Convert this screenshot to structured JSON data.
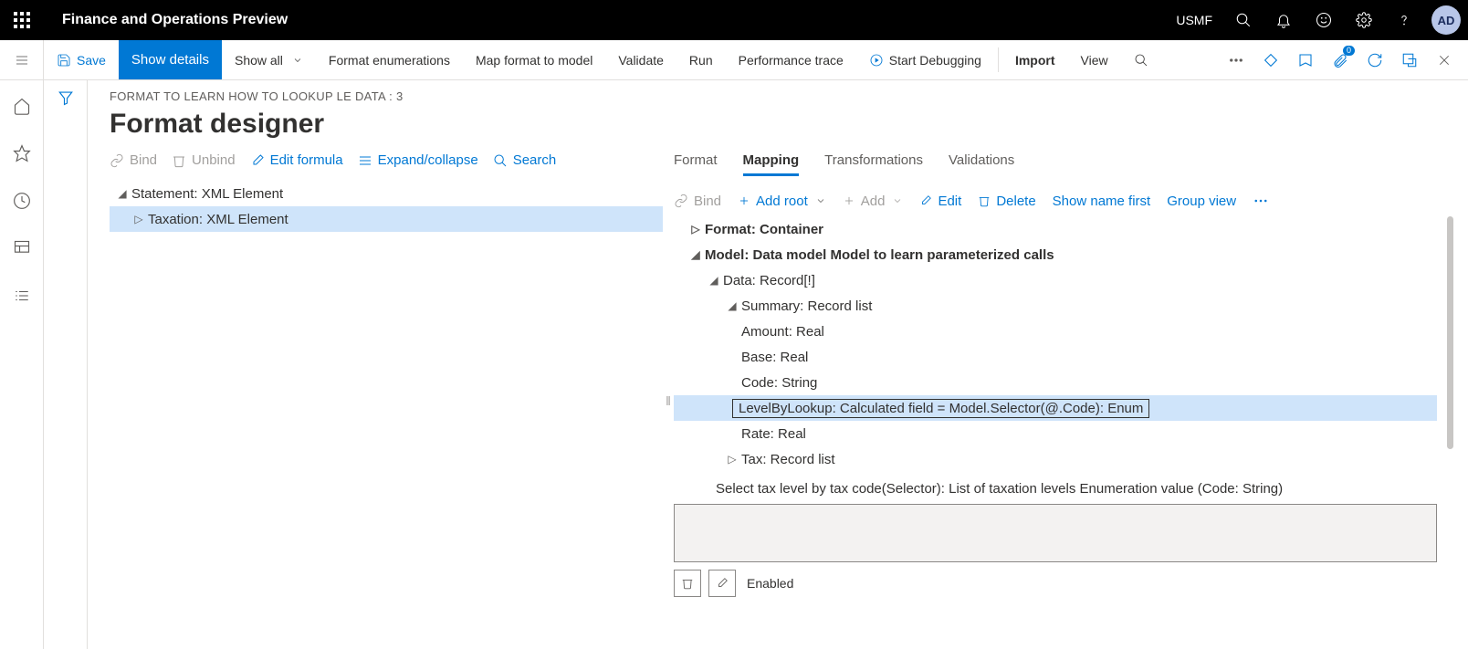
{
  "topbar": {
    "app_title": "Finance and Operations Preview",
    "entity": "USMF",
    "avatar": "AD"
  },
  "commandbar": {
    "save": "Save",
    "show_details": "Show details",
    "show_all": "Show all",
    "format_enum": "Format enumerations",
    "map_format": "Map format to model",
    "validate": "Validate",
    "run": "Run",
    "perf_trace": "Performance trace",
    "start_debug": "Start Debugging",
    "import": "Import",
    "view": "View",
    "badge_count": "0"
  },
  "page": {
    "breadcrumb": "FORMAT TO LEARN HOW TO LOOKUP LE DATA : 3",
    "title": "Format designer"
  },
  "left_toolbar": {
    "bind": "Bind",
    "unbind": "Unbind",
    "edit_formula": "Edit formula",
    "expand": "Expand/collapse",
    "search": "Search"
  },
  "left_tree": {
    "row0": "Statement: XML Element",
    "row1": "Taxation: XML Element"
  },
  "tabs": {
    "format": "Format",
    "mapping": "Mapping",
    "transformations": "Transformations",
    "validations": "Validations"
  },
  "mapping_toolbar": {
    "bind": "Bind",
    "add_root": "Add root",
    "add": "Add",
    "edit": "Edit",
    "delete": "Delete",
    "show_name_first": "Show name first",
    "group_view": "Group view"
  },
  "right_tree": {
    "r0": "Format: Container",
    "r1": "Model: Data model Model to learn parameterized calls",
    "r2": "Data: Record[!]",
    "r3": "Summary: Record list",
    "r4": "Amount: Real",
    "r5": "Base: Real",
    "r6": "Code: String",
    "r7": "LevelByLookup: Calculated field = Model.Selector(@.Code): Enum",
    "r8": "Rate: Real",
    "r9": "Tax: Record list",
    "info": "Select tax level by tax code(Selector): List of taxation levels Enumeration value (Code: String)"
  },
  "footer": {
    "enabled": "Enabled"
  }
}
